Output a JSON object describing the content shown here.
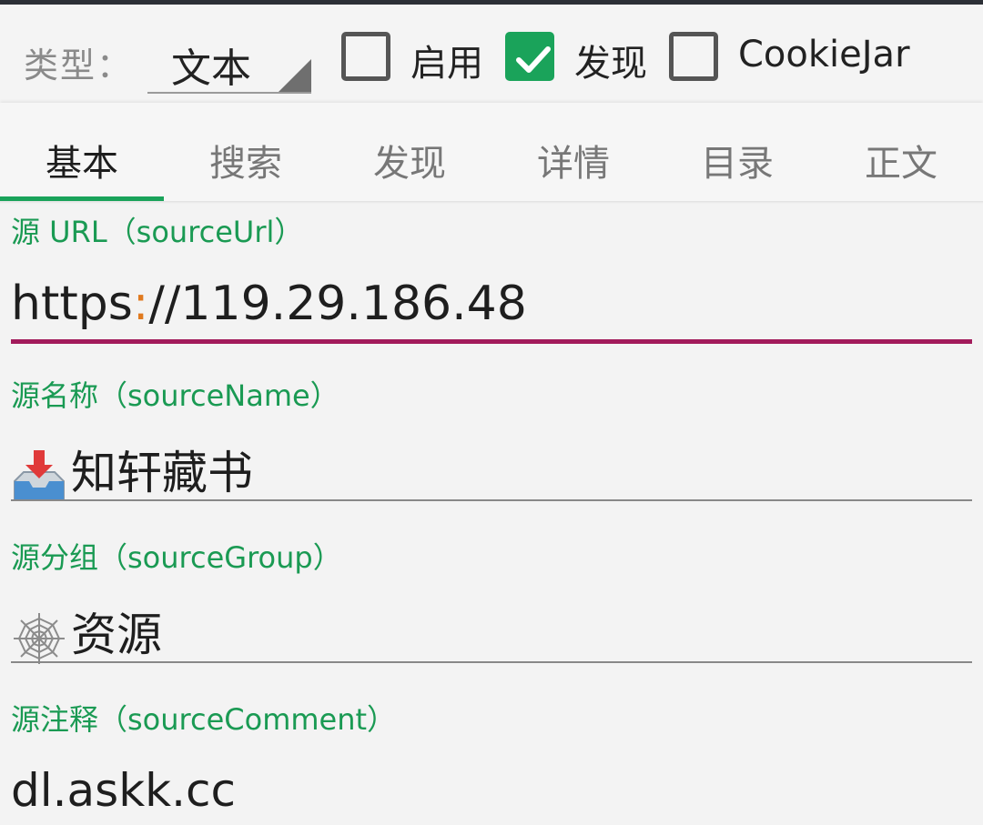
{
  "header": {
    "type_label": "类型：",
    "type_value": "文本",
    "checkboxes": [
      {
        "label": "启用",
        "checked": false
      },
      {
        "label": "发现",
        "checked": true
      },
      {
        "label": "CookieJar",
        "checked": false
      }
    ]
  },
  "tabs": [
    {
      "label": "基本",
      "active": true
    },
    {
      "label": "搜索",
      "active": false
    },
    {
      "label": "发现",
      "active": false
    },
    {
      "label": "详情",
      "active": false
    },
    {
      "label": "目录",
      "active": false
    },
    {
      "label": "正文",
      "active": false
    }
  ],
  "fields": {
    "source_url": {
      "label": "源 URL（sourceUrl）",
      "value_scheme": "https",
      "value_colon": ":",
      "value_rest": "//119.29.186.48"
    },
    "source_name": {
      "label": "源名称（sourceName）",
      "value": "知轩藏书",
      "icon": "inbox-tray-icon"
    },
    "source_group": {
      "label": "源分组（sourceGroup）",
      "value": "资源",
      "icon": "spider-web-icon"
    },
    "source_comment": {
      "label": "源注释（sourceComment）",
      "value": "dl.askk.cc"
    }
  },
  "colors": {
    "accent": "#1aa35a",
    "focus_underline": "#a21b5b",
    "label_green": "#1a9a53"
  }
}
